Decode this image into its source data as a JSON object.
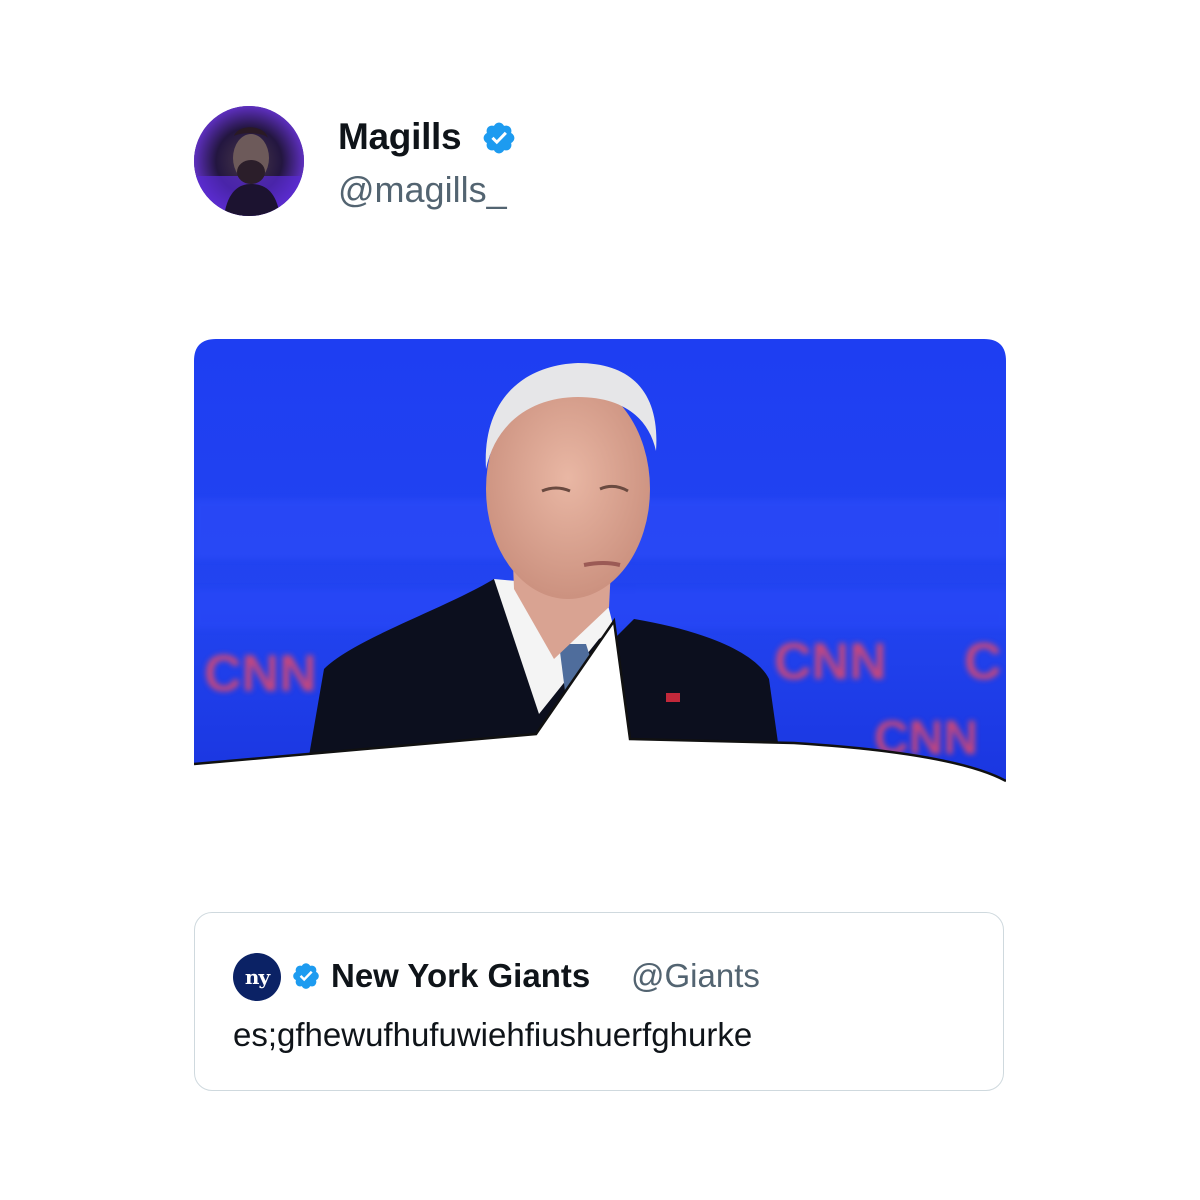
{
  "tweet": {
    "author": {
      "display_name": "Magills",
      "handle": "@magills_",
      "verified": true,
      "avatar_icon": "profile-photo"
    },
    "media": {
      "description_icon": "photo",
      "backdrop_logos": [
        "CNN",
        "CNN",
        "CNN",
        "CNN"
      ]
    },
    "quoted_tweet": {
      "display_name": "New York Giants",
      "handle": "@Giants",
      "logo_text": "ny",
      "verified": true,
      "text": "es;gfhewufhufuwiehfiushuerfghurke"
    }
  },
  "colors": {
    "verified_blue": "#1d9bf0",
    "giants_blue": "#0b2265",
    "secondary_text": "#536471",
    "primary_text": "#0f1419",
    "backdrop_blue": "#1f3ef0"
  }
}
